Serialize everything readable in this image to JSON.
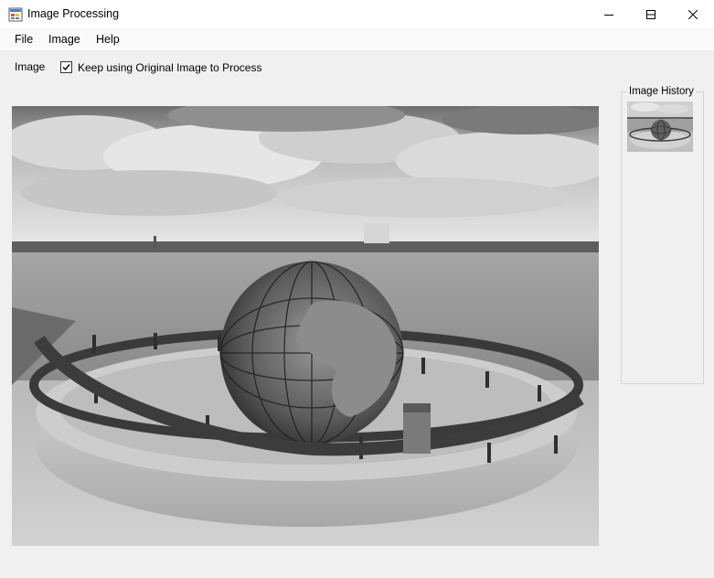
{
  "window": {
    "title": "Image Processing",
    "app_icon": "windows-app-icon",
    "controls": [
      "minimize-icon",
      "maximize-icon",
      "close-icon"
    ]
  },
  "menu": {
    "file": "File",
    "image": "Image",
    "help": "Help"
  },
  "toolbar": {
    "image_label": "Image",
    "keep_original_label": "Keep using Original Image to Process",
    "keep_original_checked": true
  },
  "history": {
    "title": "Image History",
    "thumbnails": 1
  },
  "main_image": {
    "description_icon": "grayscale-globe-sculpture-photo",
    "mode": "grayscale"
  }
}
